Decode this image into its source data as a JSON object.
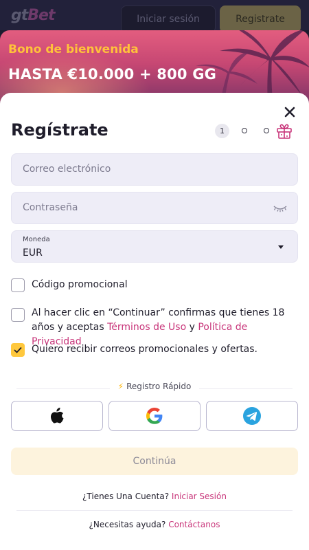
{
  "header": {
    "logo_main": "gt",
    "logo_accent": "Bet",
    "login_label": "Iniciar sesión",
    "register_label": "Registrate"
  },
  "banner": {
    "kicker": "Bono de bienvenida",
    "title": "HASTA €10.000 + 800 GG"
  },
  "modal": {
    "title": "Regístrate",
    "steps": {
      "current": "1",
      "icon": "gift-icon"
    },
    "email": {
      "placeholder": "Correo electrónico"
    },
    "password": {
      "placeholder": "Contraseña",
      "icon": "eye-closed-icon"
    },
    "currency": {
      "label": "Moneda",
      "value": "EUR"
    },
    "promo_code_label": "Código promocional",
    "terms": {
      "text_before": "Al hacer clic en “Continuar” confirmas que tienes 18 años y aceptas ",
      "terms_link": "Términos de Uso",
      "and": " y ",
      "privacy_link": "Política de Privacidad",
      "checked": false
    },
    "newsletter": {
      "label": "Quiero recibir correos promocionales y ofertas.",
      "checked": true
    },
    "quick_register": {
      "icon": "lightning-icon",
      "label": "Registro Rápido"
    },
    "social": [
      "apple-icon",
      "google-icon",
      "telegram-icon"
    ],
    "continue_label": "Continúa",
    "account": {
      "question": "¿Tienes Una Cuenta?",
      "link": "Iniciar Sesión"
    },
    "help": {
      "question": "¿Necesitas ayuda?",
      "link": "Contáctanos"
    }
  },
  "colors": {
    "accent_yellow": "#ffc83d",
    "link_pink": "#c8357a",
    "field_bg": "#eeedf7",
    "banner_pink": "#e35d7f"
  }
}
